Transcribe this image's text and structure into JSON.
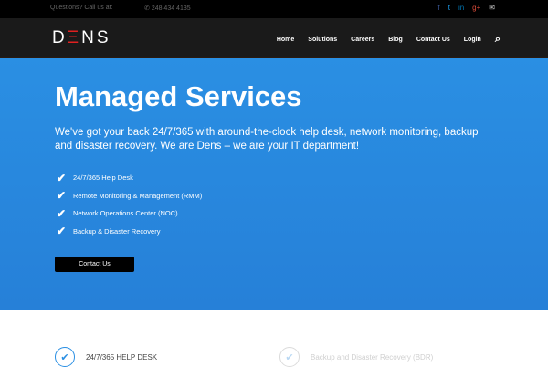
{
  "topbar": {
    "question": "Questions? Call us at:",
    "phone": "248 434 4135",
    "social": [
      "facebook",
      "twitter",
      "linkedin",
      "google-plus",
      "email"
    ]
  },
  "nav": {
    "logo_d": "D",
    "logo_e": "Ξ",
    "logo_ns": "NS",
    "items": [
      "Home",
      "Solutions",
      "Careers",
      "Blog",
      "Contact Us",
      "Login"
    ]
  },
  "hero": {
    "title": "Managed Services",
    "subtitle": "We've got your back 24/7/365 with around-the-clock help desk, network monitoring, backup and disaster recovery. We are Dens – we are your IT department!",
    "list": [
      "24/7/365 Help Desk",
      "Remote Monitoring & Management (RMM)",
      "Network Operations Center (NOC)",
      "Backup & Disaster Recovery"
    ],
    "button": "Contact Us"
  },
  "features": [
    "24/7/365 HELP DESK",
    "Backup and Disaster Recovery (BDR)"
  ]
}
